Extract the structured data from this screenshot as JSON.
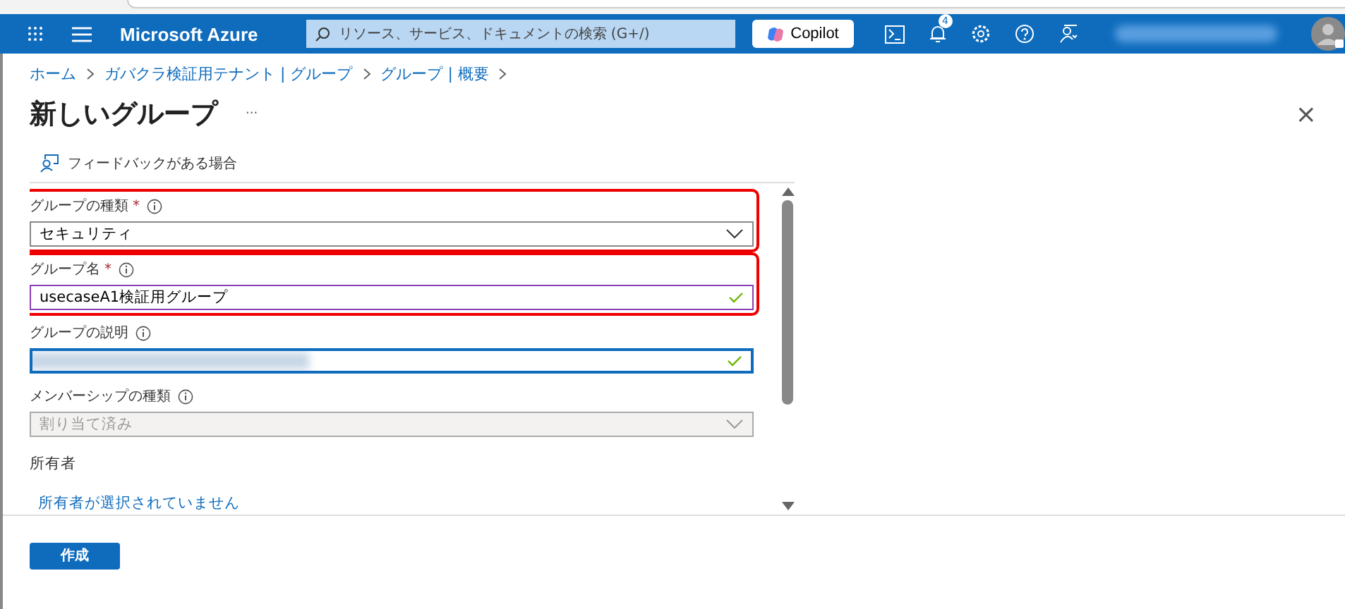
{
  "header": {
    "brand": "Microsoft Azure",
    "search": {
      "placeholder": "リソース、サービス、ドキュメントの検索 (G+/)"
    },
    "copilot": "Copilot",
    "notification_count": "4"
  },
  "breadcrumb": [
    "ホーム",
    "ガバクラ検証用テナント | グループ",
    "グループ | 概要"
  ],
  "title": "新しいグループ",
  "more": "···",
  "close": "×",
  "feedback": "フィードバックがある場合",
  "fields": [
    {
      "kind": "select",
      "label": "グループの種類",
      "required_mark": "*",
      "value": "セキュリティ",
      "disabled": false,
      "valid": false,
      "hovered": false,
      "focused": false,
      "highlighted": true
    },
    {
      "kind": "text",
      "label": "グループ名",
      "required_mark": "*",
      "value": "usecaseA1検証用グループ",
      "disabled": false,
      "valid": true,
      "hovered": true,
      "focused": false,
      "highlighted": true
    },
    {
      "kind": "text",
      "label": "グループの説明",
      "blurred": true,
      "disabled": false,
      "valid": true,
      "focused": true,
      "highlighted": false
    },
    {
      "kind": "select",
      "label": "メンバーシップの種類",
      "value": "割り当て済み",
      "disabled": true,
      "valid": false,
      "hovered": false,
      "focused": false,
      "highlighted": false
    }
  ],
  "owners": {
    "label": "所有者",
    "link": "所有者が選択されていません"
  },
  "create_button": "作成"
}
